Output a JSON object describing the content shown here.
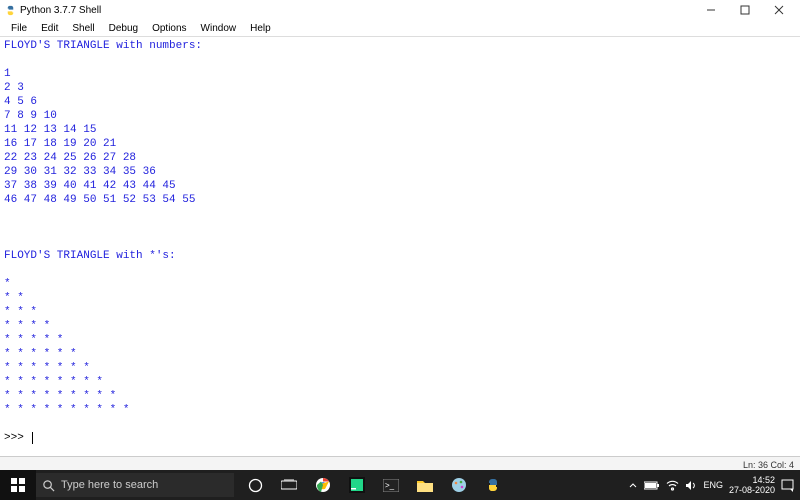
{
  "window": {
    "title": "Python 3.7.7 Shell",
    "menu": [
      "File",
      "Edit",
      "Shell",
      "Debug",
      "Options",
      "Window",
      "Help"
    ]
  },
  "shell_output": "FLOYD'S TRIANGLE with numbers:\n\n1\n2 3\n4 5 6\n7 8 9 10\n11 12 13 14 15\n16 17 18 19 20 21\n22 23 24 25 26 27 28\n29 30 31 32 33 34 35 36\n37 38 39 40 41 42 43 44 45\n46 47 48 49 50 51 52 53 54 55\n\n\n\nFLOYD'S TRIANGLE with *'s:\n\n*\n* *\n* * *\n* * * *\n* * * * *\n* * * * * *\n* * * * * * *\n* * * * * * * *\n* * * * * * * * *\n* * * * * * * * * *\n",
  "prompt": ">>> ",
  "statusbar": "Ln: 36  Col: 4",
  "taskbar": {
    "search_placeholder": "Type here to search",
    "lang": "ENG",
    "time": "14:52",
    "date": "27-08-2020"
  }
}
